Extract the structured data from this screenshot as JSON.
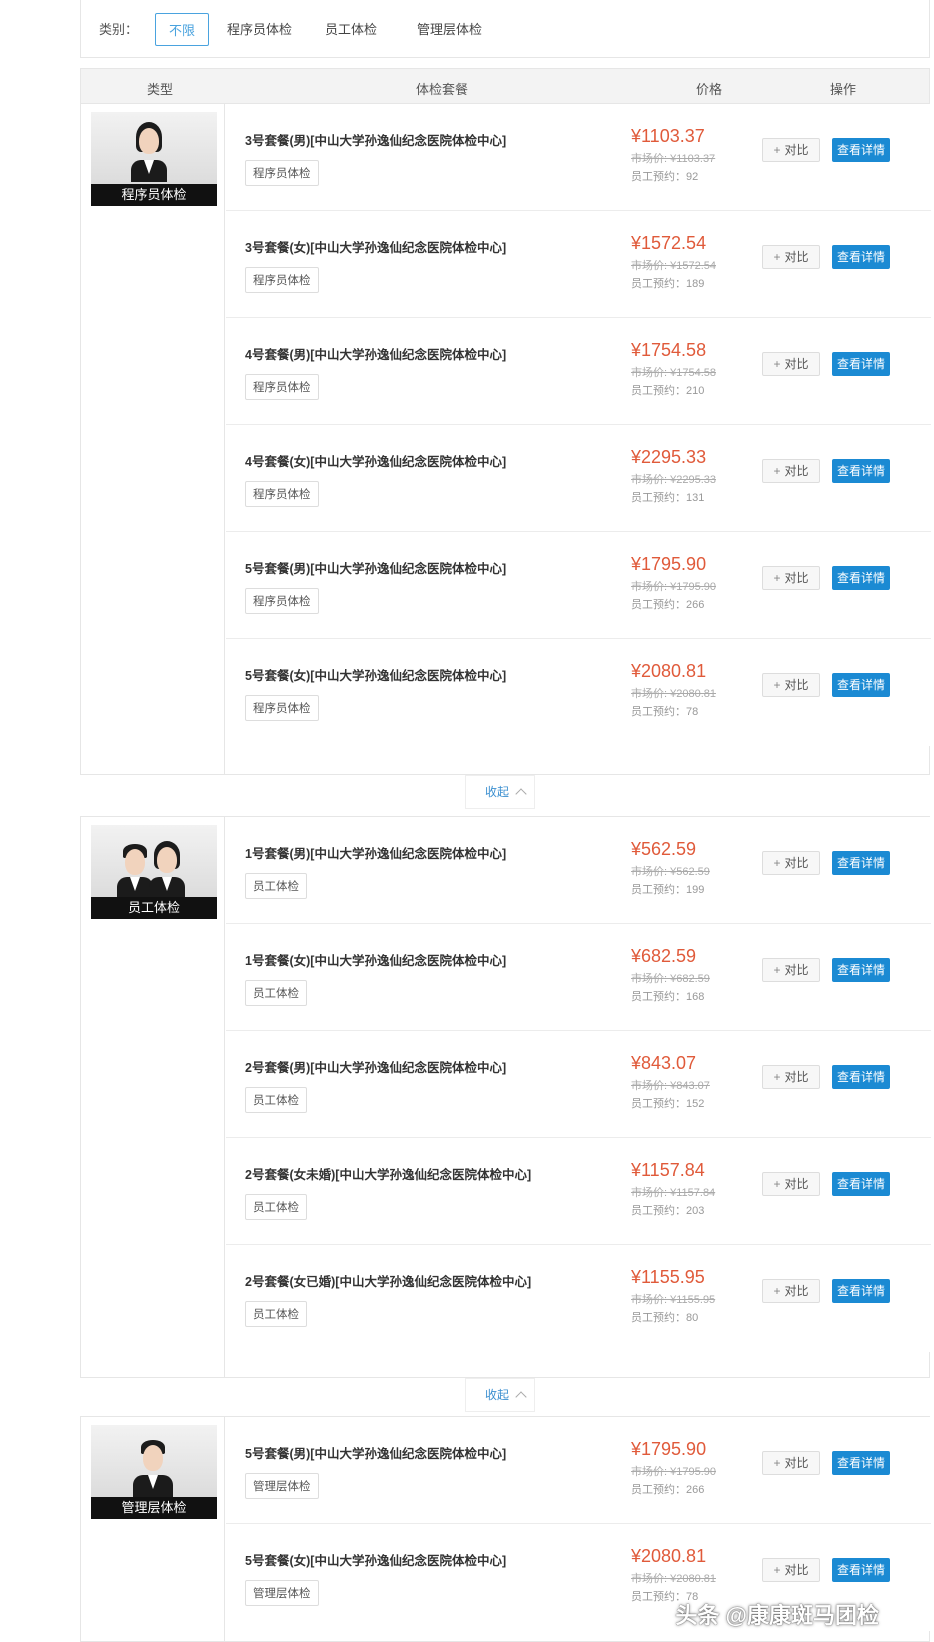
{
  "filter": {
    "label": "类别：",
    "options": [
      "不限",
      "程序员体检",
      "员工体检",
      "管理层体检"
    ]
  },
  "table_head": {
    "type": "类型",
    "package": "体检套餐",
    "price": "价格",
    "action": "操作"
  },
  "collapse_label": "收起",
  "buttons": {
    "compare": "对比",
    "detail": "查看详情"
  },
  "groups": [
    {
      "type_label": "程序员体检",
      "rows": [
        {
          "name": "3号套餐(男)[中山大学孙逸仙纪念医院体检中心]",
          "tag": "程序员体检",
          "price": "¥1103.37",
          "market": "市场价: ¥1103.37",
          "booked": "员工预约：92"
        },
        {
          "name": "3号套餐(女)[中山大学孙逸仙纪念医院体检中心]",
          "tag": "程序员体检",
          "price": "¥1572.54",
          "market": "市场价: ¥1572.54",
          "booked": "员工预约：189"
        },
        {
          "name": "4号套餐(男)[中山大学孙逸仙纪念医院体检中心]",
          "tag": "程序员体检",
          "price": "¥1754.58",
          "market": "市场价: ¥1754.58",
          "booked": "员工预约：210"
        },
        {
          "name": "4号套餐(女)[中山大学孙逸仙纪念医院体检中心]",
          "tag": "程序员体检",
          "price": "¥2295.33",
          "market": "市场价: ¥2295.33",
          "booked": "员工预约：131"
        },
        {
          "name": "5号套餐(男)[中山大学孙逸仙纪念医院体检中心]",
          "tag": "程序员体检",
          "price": "¥1795.90",
          "market": "市场价: ¥1795.90",
          "booked": "员工预约：266"
        },
        {
          "name": "5号套餐(女)[中山大学孙逸仙纪念医院体检中心]",
          "tag": "程序员体检",
          "price": "¥2080.81",
          "market": "市场价: ¥2080.81",
          "booked": "员工预约：78"
        }
      ]
    },
    {
      "type_label": "员工体检",
      "rows": [
        {
          "name": "1号套餐(男)[中山大学孙逸仙纪念医院体检中心]",
          "tag": "员工体检",
          "price": "¥562.59",
          "market": "市场价: ¥562.59",
          "booked": "员工预约：199"
        },
        {
          "name": "1号套餐(女)[中山大学孙逸仙纪念医院体检中心]",
          "tag": "员工体检",
          "price": "¥682.59",
          "market": "市场价: ¥682.59",
          "booked": "员工预约：168"
        },
        {
          "name": "2号套餐(男)[中山大学孙逸仙纪念医院体检中心]",
          "tag": "员工体检",
          "price": "¥843.07",
          "market": "市场价: ¥843.07",
          "booked": "员工预约：152"
        },
        {
          "name": "2号套餐(女未婚)[中山大学孙逸仙纪念医院体检中心]",
          "tag": "员工体检",
          "price": "¥1157.84",
          "market": "市场价: ¥1157.84",
          "booked": "员工预约：203"
        },
        {
          "name": "2号套餐(女已婚)[中山大学孙逸仙纪念医院体检中心]",
          "tag": "员工体检",
          "price": "¥1155.95",
          "market": "市场价: ¥1155.95",
          "booked": "员工预约：80"
        }
      ]
    },
    {
      "type_label": "管理层体检",
      "rows": [
        {
          "name": "5号套餐(男)[中山大学孙逸仙纪念医院体检中心]",
          "tag": "管理层体检",
          "price": "¥1795.90",
          "market": "市场价: ¥1795.90",
          "booked": "员工预约：266"
        },
        {
          "name": "5号套餐(女)[中山大学孙逸仙纪念医院体检中心]",
          "tag": "管理层体检",
          "price": "¥2080.81",
          "market": "市场价: ¥2080.81",
          "booked": "员工预约：78"
        }
      ]
    }
  ],
  "watermark": "头条 @康康斑马团检",
  "colors": {
    "price": "#e05a3a",
    "detail_button": "#1b8ad3",
    "active_filter": "#4aa3df",
    "caption_bg": "#111111"
  }
}
